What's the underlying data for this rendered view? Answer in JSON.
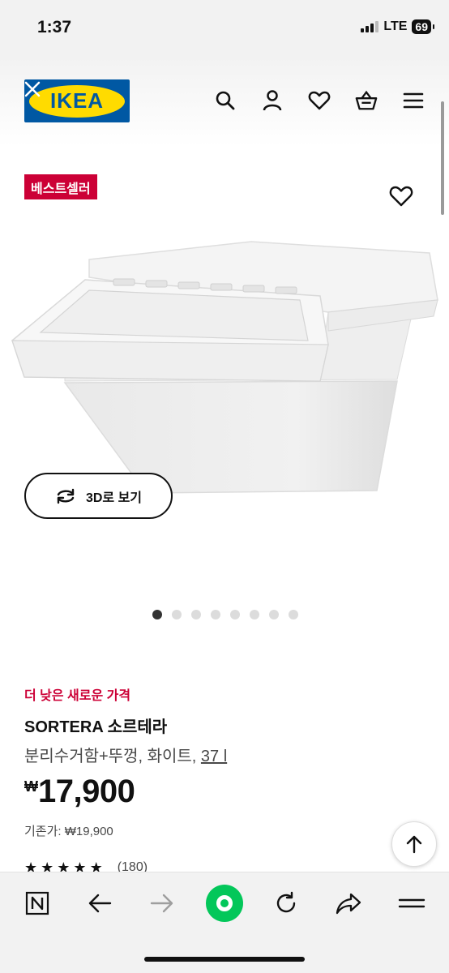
{
  "status_bar": {
    "time": "1:37",
    "network": "LTE",
    "battery": "69"
  },
  "header": {
    "logo_text": "IKEA",
    "icons": [
      "search-icon",
      "user-icon",
      "heart-icon",
      "basket-icon",
      "menu-icon"
    ]
  },
  "product": {
    "badge": "베스트셀러",
    "view_3d_label": "3D로 보기",
    "gallery_total": 8,
    "gallery_active": 1,
    "promo_label": "더 낮은 새로운 가격",
    "name": "SORTERA 소르테라",
    "description": "분리수거함+뚜껑, 화이트,",
    "size": "37 l",
    "currency": "₩",
    "price": "17,900",
    "previous_price": "기존가: ₩19,900",
    "rating_stars": 4.5,
    "rating_count": "(180)"
  },
  "colors": {
    "ikea_blue": "#0058a3",
    "ikea_yellow": "#ffdb00",
    "badge_red": "#cc0036",
    "naver_green": "#03c75a"
  },
  "browser_bar": {
    "icons": [
      "naver-n-icon",
      "back-arrow-icon",
      "forward-arrow-icon",
      "naver-green-button",
      "refresh-icon",
      "share-icon",
      "menu-icon"
    ]
  }
}
